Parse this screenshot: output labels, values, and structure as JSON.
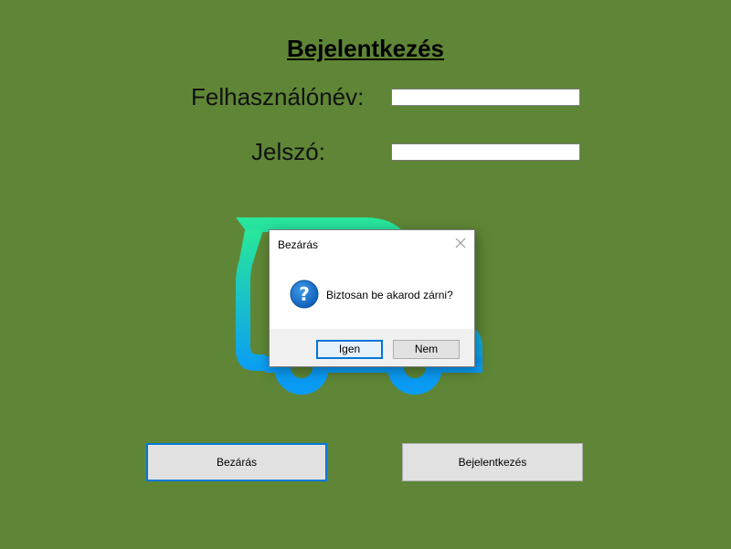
{
  "form": {
    "title": "Bejelentkezés",
    "username_label": "Felhasználónév:",
    "username_value": "",
    "password_label": "Jelszó:",
    "password_value": ""
  },
  "buttons": {
    "close_label": "Bezárás",
    "login_label": "Bejelentkezés"
  },
  "logo": {
    "icon": "truck-logo-icon",
    "gradient_start": "#28e89a",
    "gradient_end": "#0a9cf5"
  },
  "dialog": {
    "title": "Bezárás",
    "message": "Biztosan be akarod zárni?",
    "icon": "question-icon",
    "yes_label": "Igen",
    "no_label": "Nem"
  },
  "colors": {
    "background": "#5f8636",
    "focus_accent": "#0078d7"
  }
}
